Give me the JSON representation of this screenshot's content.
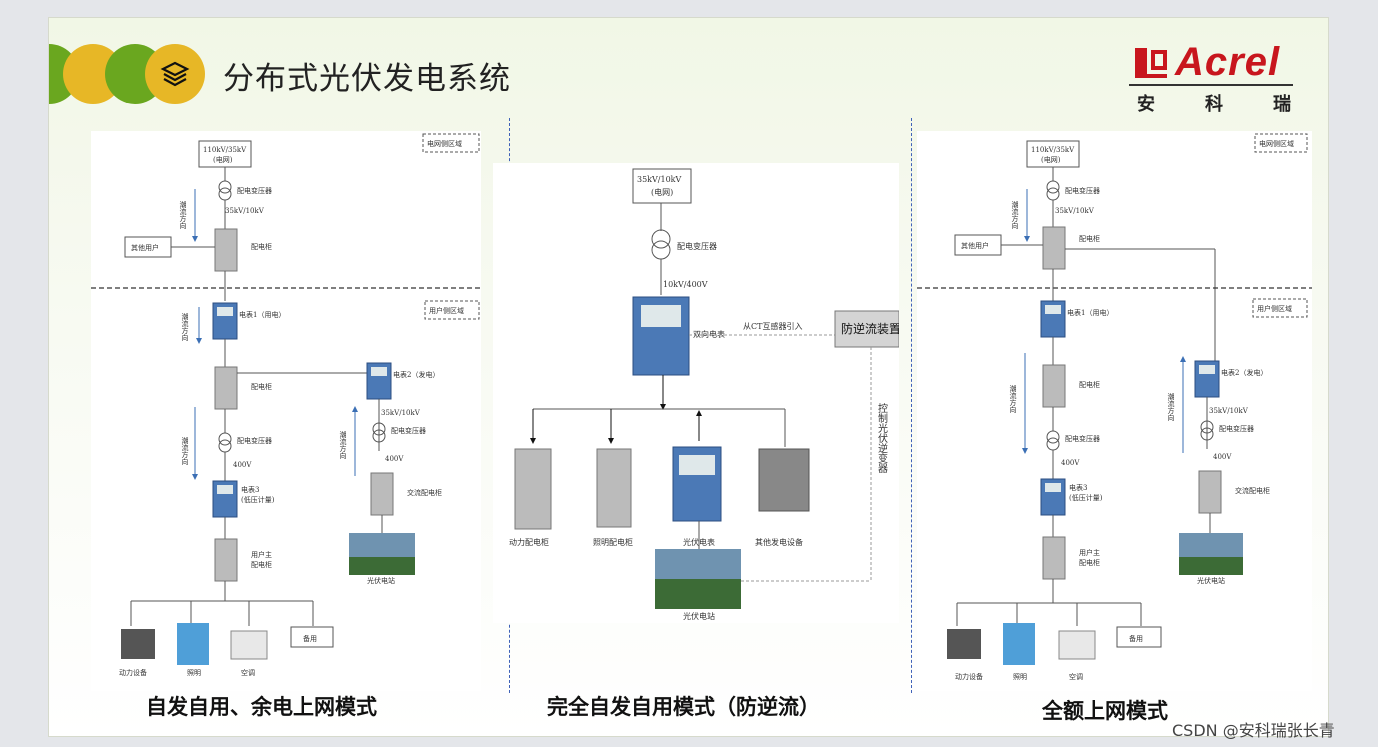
{
  "header": {
    "title": "分布式光伏发电系统",
    "icon": "layers-icon",
    "logo": {
      "word": "Acrel",
      "cn": [
        "安",
        "科",
        "瑞"
      ]
    }
  },
  "colors": {
    "green": "#6aa71f",
    "yellow": "#e7b726",
    "brand_red": "#c8161d",
    "divider_blue": "#3f62b8"
  },
  "panel1": {
    "grid_zone": "电网侧区域",
    "user_zone": "用户侧区域",
    "source": "110kV/35kV",
    "source_sub": "(电网)",
    "transformer": "配电变压器",
    "voltage1": "35kV/10kV",
    "flow_1": "潮流方向",
    "other_users": "其他用户",
    "cabinet": "配电柜",
    "meter1": "电表1（用电）",
    "flow_2": "潮流方向",
    "cabinet2": "配电柜",
    "meter2": "电表2（发电）",
    "voltage2": "35kV/10kV",
    "transformer2": "配电变压器",
    "flow_3": "潮流方向",
    "transformer3": "配电变压器",
    "voltage3": "400V",
    "meter3_a": "电表3",
    "meter3_b": "(低压计量)",
    "voltage4": "400V",
    "ac_cabinet": "交流配电柜",
    "user_cabinet_a": "用户主",
    "user_cabinet_b": "配电柜",
    "pv_station": "光伏电站",
    "spare": "备用",
    "power_equipment": "动力设备",
    "lighting": "照明",
    "aircon": "空调",
    "flow_4": "潮流方向"
  },
  "panel2": {
    "source": "35kV/10kV",
    "source_sub": "(电网)",
    "transformer": "配电变压器",
    "voltage": "10kV/400V",
    "ct_text": "从CT互感器引入",
    "anti_reverse": "防逆流装置",
    "bidirectional_meter": "双向电表",
    "control_text": "控制光伏逆变器",
    "power_cabinet": "动力配电柜",
    "lighting_cabinet": "照明配电柜",
    "pv_meter": "光伏电表",
    "other_gen": "其他发电设备",
    "pv_station": "光伏电站"
  },
  "panel3": {
    "grid_zone": "电网侧区域",
    "user_zone": "用户侧区域",
    "source": "110kV/35kV",
    "source_sub": "(电网)",
    "transformer": "配电变压器",
    "voltage1": "35kV/10kV",
    "flow_1": "潮流方向",
    "other_users": "其他用户",
    "cabinet": "配电柜",
    "meter1": "电表1（用电）",
    "cabinet2": "配电柜",
    "meter2": "电表2（发电）",
    "voltage2": "35kV/10kV",
    "transformer2": "配电变压器",
    "flow_2": "潮流方向",
    "flow_3": "潮流方向",
    "transformer3": "配电变压器",
    "voltage3": "400V",
    "meter3_a": "电表3",
    "meter3_b": "(低压计量)",
    "voltage4": "400V",
    "ac_cabinet": "交流配电柜",
    "user_cabinet_a": "用户主",
    "user_cabinet_b": "配电柜",
    "pv_station": "光伏电站",
    "spare": "备用",
    "power_equipment": "动力设备",
    "lighting": "照明",
    "aircon": "空调"
  },
  "captions": {
    "mode1": "自发自用、余电上网模式",
    "mode2": "完全自发自用模式（防逆流）",
    "mode3": "全额上网模式"
  },
  "watermark": "CSDN @安科瑞张长青"
}
